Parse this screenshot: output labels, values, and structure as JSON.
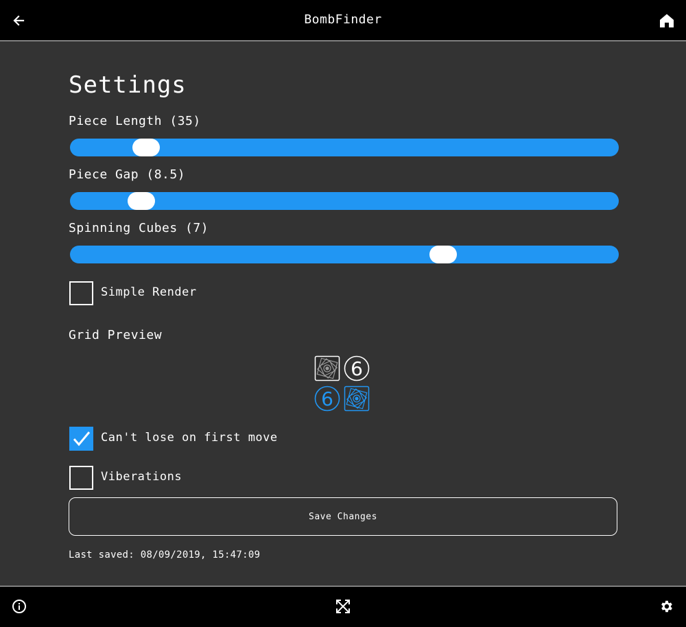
{
  "app": {
    "title": "BombFinder"
  },
  "header": {
    "back_icon": "arrow-left-icon",
    "home_icon": "home-icon"
  },
  "page": {
    "title": "Settings"
  },
  "sliders": [
    {
      "label": "Piece Length (35)",
      "value": 35,
      "level": 0.12
    },
    {
      "label": "Piece Gap (8.5)",
      "value": 8.5,
      "level": 0.11
    },
    {
      "label": "Spinning Cubes (7)",
      "value": 7,
      "level": 0.69
    }
  ],
  "checkboxes": {
    "simple_render": {
      "label": "Simple Render",
      "checked": false
    },
    "cant_lose": {
      "label": "Can't lose on first move",
      "checked": true
    },
    "vibrations": {
      "label": "Viberations",
      "checked": false
    }
  },
  "grid_preview": {
    "title": "Grid Preview",
    "cells": [
      {
        "content": "bomb-icon",
        "color": "#888888",
        "number": ""
      },
      {
        "content": "number",
        "color": "#ffffff",
        "number": "6"
      },
      {
        "content": "number",
        "color": "#2196f3",
        "number": "6"
      },
      {
        "content": "bomb-icon",
        "color": "#2196f3",
        "number": ""
      }
    ]
  },
  "actions": {
    "save_label": "Save Changes"
  },
  "status": {
    "last_saved": "Last saved: 08/09/2019, 15:47:09"
  },
  "footer": {
    "info_icon": "info-icon",
    "expand_icon": "expand-icon",
    "settings_icon": "gear-icon"
  },
  "colors": {
    "accent": "#2196f3",
    "background": "#333333",
    "bars": "#000000"
  }
}
